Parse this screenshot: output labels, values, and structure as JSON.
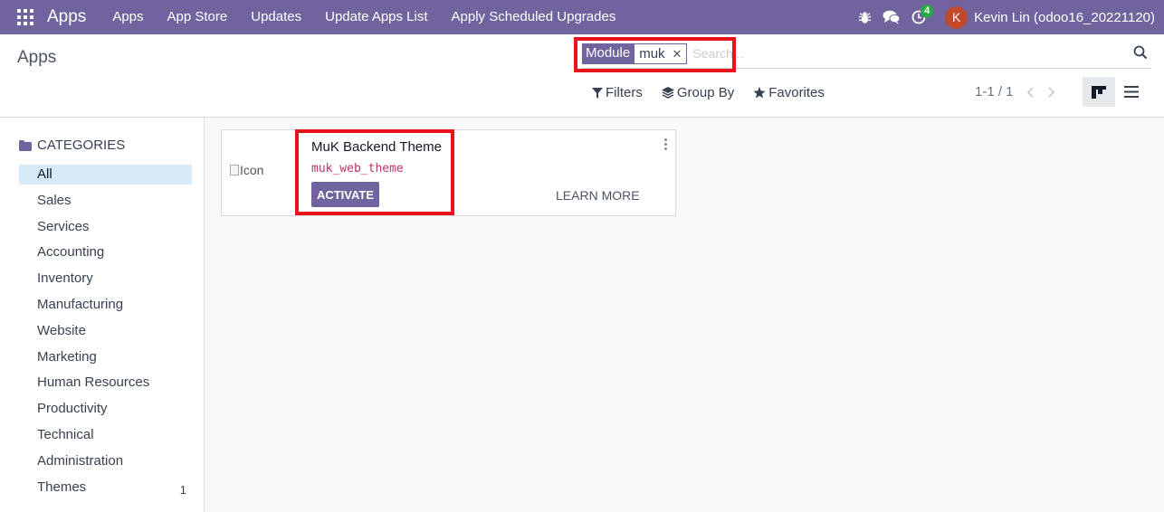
{
  "navbar": {
    "brand": "Apps",
    "menu": [
      "Apps",
      "App Store",
      "Updates",
      "Update Apps List",
      "Apply Scheduled Upgrades"
    ],
    "activity_count": "4",
    "user_initial": "K",
    "user_name": "Kevin Lin (odoo16_20221120)",
    "icons": [
      "apps-grid-icon",
      "bug-icon",
      "chat-icon",
      "clock-icon"
    ]
  },
  "control_panel": {
    "breadcrumb": "Apps",
    "search": {
      "facet_label": "Module",
      "facet_value": "muk",
      "placeholder": "Search..."
    },
    "filters_label": "Filters",
    "group_by_label": "Group By",
    "favorites_label": "Favorites",
    "pager": "1-1 / 1"
  },
  "sidebar": {
    "header": "CATEGORIES",
    "items": [
      {
        "label": "All",
        "active": true
      },
      {
        "label": "Sales"
      },
      {
        "label": "Services"
      },
      {
        "label": "Accounting"
      },
      {
        "label": "Inventory"
      },
      {
        "label": "Manufacturing"
      },
      {
        "label": "Website"
      },
      {
        "label": "Marketing"
      },
      {
        "label": "Human Resources"
      },
      {
        "label": "Productivity"
      },
      {
        "label": "Technical"
      },
      {
        "label": "Administration"
      },
      {
        "label": "Themes",
        "count": "1"
      }
    ]
  },
  "card": {
    "icon_alt": "Icon",
    "title": "MuK Backend Theme",
    "module": "muk_web_theme",
    "activate_label": "ACTIVATE",
    "learn_more_label": "LEARN MORE"
  },
  "colors": {
    "brand": "#71639e",
    "highlight": "#e8131b",
    "active_category": "#d6eaf7",
    "module_text": "#b8366a"
  }
}
